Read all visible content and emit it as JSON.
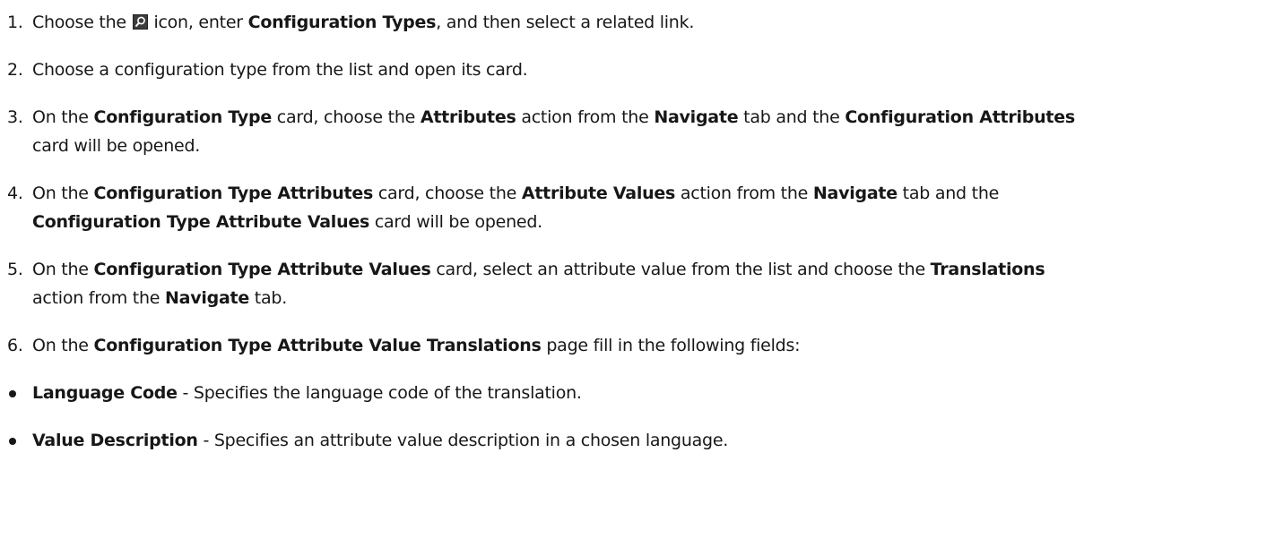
{
  "steps": [
    {
      "num": "1.",
      "p1": "Choose the ",
      "icon": "search-icon",
      "p2": " icon, enter ",
      "b1": "Configuration Types",
      "p3": ", and then select a related link."
    },
    {
      "num": "2.",
      "text": "Choose a configuration type from the list and open its card."
    },
    {
      "num": "3.",
      "p1": "On the ",
      "b1": "Configuration Type",
      "p2": " card, choose the ",
      "b2": "Attributes",
      "p3": " action from the ",
      "b3": "Navigate",
      "p4": " tab and the ",
      "b4": "Configuration Attributes",
      "p5": "card will be opened."
    },
    {
      "num": "4.",
      "p1": "On the ",
      "b1": "Configuration Type Attributes",
      "p2": " card, choose the ",
      "b2": "Attribute Values",
      "p3": " action from the ",
      "b3": "Navigate",
      "p4": " tab and the",
      "b4": "Configuration Type Attribute Values",
      "p5": " card will be opened."
    },
    {
      "num": "5.",
      "p1": "On the ",
      "b1": "Configuration Type Attribute Values",
      "p2": " card, select an attribute value from the list and choose the ",
      "b2": "Translations",
      "p3": "action from the ",
      "b3": "Navigate",
      "p4": " tab."
    },
    {
      "num": "6.",
      "p1": "On the ",
      "b1": "Configuration Type Attribute Value Translations",
      "p2": " page fill in the following fields:"
    }
  ],
  "fields": [
    {
      "name": "Language Code",
      "desc": " - Specifies the language code of the translation."
    },
    {
      "name": "Value Description",
      "desc": " - Specifies an attribute value description in a chosen language."
    }
  ]
}
